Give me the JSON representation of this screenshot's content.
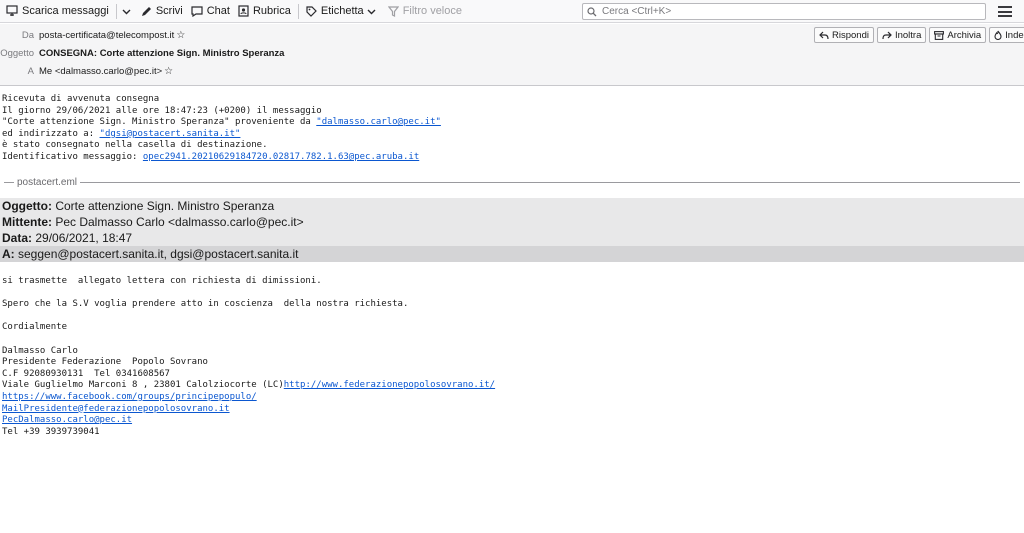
{
  "toolbar": {
    "get_messages": "Scarica messaggi",
    "write": "Scrivi",
    "chat": "Chat",
    "address_book": "Rubrica",
    "tag": "Etichetta",
    "quick_filter": "Filtro veloce",
    "search_placeholder": "Cerca <Ctrl+K>"
  },
  "header": {
    "from_label": "Da",
    "from_value": "posta-certificata@telecompost.it",
    "subject_label": "Oggetto",
    "subject_value": "CONSEGNA: Corte attenzione Sign. Ministro Speranza",
    "to_label": "A",
    "to_value": "Me <dalmasso.carlo@pec.it>",
    "actions": {
      "reply": "Rispondi",
      "forward": "Inoltra",
      "archive": "Archivia",
      "junk": "Indeside"
    }
  },
  "receipt": {
    "line1": "Ricevuta di avvenuta consegna",
    "line2": "Il giorno 29/06/2021 alle ore 18:47:23 (+0200) il messaggio",
    "line3_pre": "\"Corte attenzione Sign. Ministro Speranza\" proveniente da ",
    "line3_link": "\"dalmasso.carlo@pec.it\"",
    "line4_pre": "ed indirizzato a: ",
    "line4_link": "\"dgsi@postacert.sanita.it\"",
    "line5": "è stato consegnato nella casella di destinazione.",
    "line6_pre": "Identificativo messaggio: ",
    "line6_link": "opec2941.20210629184720.02817.782.1.63@pec.aruba.it"
  },
  "attachment": {
    "name": "postacert.eml"
  },
  "forwarded": {
    "subject_label": "Oggetto:",
    "subject_value": " Corte attenzione Sign. Ministro Speranza",
    "sender_label": "Mittente:",
    "sender_value": " Pec Dalmasso Carlo <dalmasso.carlo@pec.it>",
    "date_label": "Data:",
    "date_value": " 29/06/2021, 18:47",
    "to_label": "A:",
    "to_value": " seggen@postacert.sanita.it, dgsi@postacert.sanita.it"
  },
  "body": {
    "line1": "si trasmette  allegato lettera con richiesta di dimissioni.",
    "line2": "Spero che la S.V voglia prendere atto in coscienza  della nostra richiesta.",
    "line3": "Cordialmente",
    "sig_name": "Dalmasso Carlo",
    "sig_role": "Presidente Federazione  Popolo Sovrano",
    "sig_cf": "C.F 92080930131  Tel 0341608567",
    "sig_addr_pre": "Viale Guglielmo Marconi 8 , 23801 Calolziocorte (LC)",
    "sig_site": "http://www.federazionepopolosovrano.it/",
    "sig_fb": "https://www.facebook.com/groups/principepopulo/",
    "sig_mail": "MailPresidente@federazionepopolosovrano.it",
    "sig_pec": "PecDalmasso.carlo@pec.it",
    "sig_tel": "Tel +39 3939739041"
  }
}
